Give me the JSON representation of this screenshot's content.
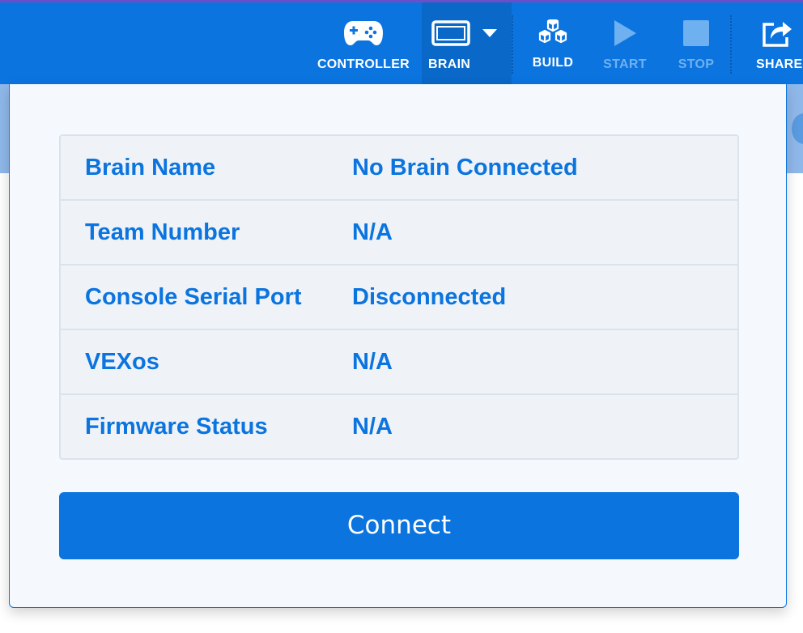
{
  "toolbar": {
    "controller_label": "CONTROLLER",
    "brain_label": "BRAIN",
    "build_label": "BUILD",
    "start_label": "START",
    "stop_label": "STOP",
    "share_label": "SHARE"
  },
  "brain_info": {
    "rows": [
      {
        "label": "Brain Name",
        "value": "No Brain Connected"
      },
      {
        "label": "Team Number",
        "value": "N/A"
      },
      {
        "label": "Console Serial Port",
        "value": "Disconnected"
      },
      {
        "label": "VEXos",
        "value": "N/A"
      },
      {
        "label": "Firmware Status",
        "value": "N/A"
      }
    ],
    "connect_label": "Connect"
  },
  "icons": {
    "controller": "gamepad-icon",
    "brain": "brain-screen-icon",
    "dropdown": "caret-down-icon",
    "build": "cubes-icon",
    "start": "play-icon",
    "stop": "stop-icon",
    "share": "share-icon"
  },
  "colors": {
    "accent": "#0b74df",
    "panel_background": "#f5f9fe",
    "table_background": "#eff3f8",
    "disabled_text": "#6fb0f0"
  }
}
